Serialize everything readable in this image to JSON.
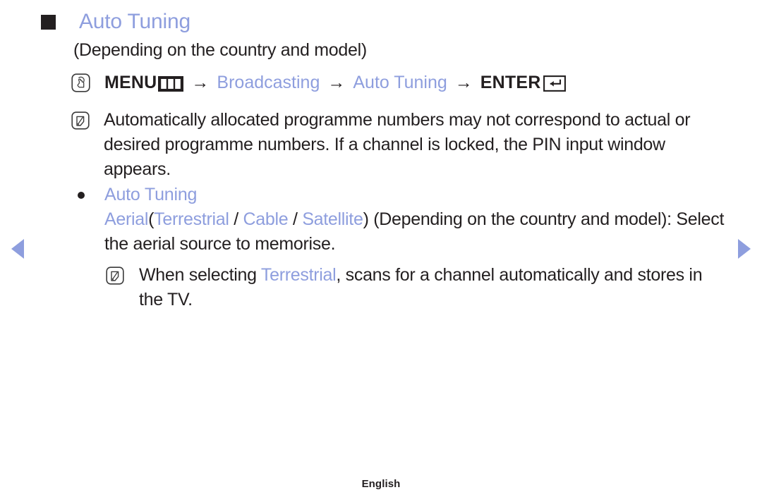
{
  "document": {
    "title": "Auto Tuning",
    "subtitle": "(Depending on the country and model)",
    "footer_language": "English"
  },
  "menu_path": {
    "press_icon": "hand-press-icon",
    "menu_label": "MENU",
    "menu_keycap_icon": "menu-keycap-icon",
    "arrow": "→",
    "step_broadcasting": "Broadcasting",
    "step_auto_tuning": "Auto Tuning",
    "enter_label": "ENTER",
    "enter_keycap_icon": "enter-keycap-icon"
  },
  "notes": [
    {
      "icon": "note-pencil-icon",
      "text": "Automatically allocated programme numbers may not correspond to actual or desired programme numbers. If a channel is locked, the PIN input window appears."
    },
    {
      "icon": "note-pencil-icon",
      "text_before": "When selecting ",
      "highlight": "Terrestrial",
      "text_after": ", scans for a channel automatically and stores in the TV."
    }
  ],
  "bullet_section": {
    "bullet_icon": "round-bullet-icon",
    "heading": "Auto Tuning",
    "source_aerial": "Aerial",
    "paren_open": "(",
    "source_terrestrial": "Terrestrial",
    "slash_1": " / ",
    "source_cable": "Cable",
    "slash_2": " / ",
    "source_satellite": "Satellite",
    "paren_close": ")",
    "depending_note": " (Depending on the country and model):",
    "instruction": "Select the aerial source to memorise."
  },
  "navigation": {
    "prev_label": "previous-page-arrow",
    "next_label": "next-page-arrow"
  },
  "colors": {
    "accent_blue": "#8e9ede",
    "text_black": "#231f20",
    "background": "#ffffff"
  }
}
